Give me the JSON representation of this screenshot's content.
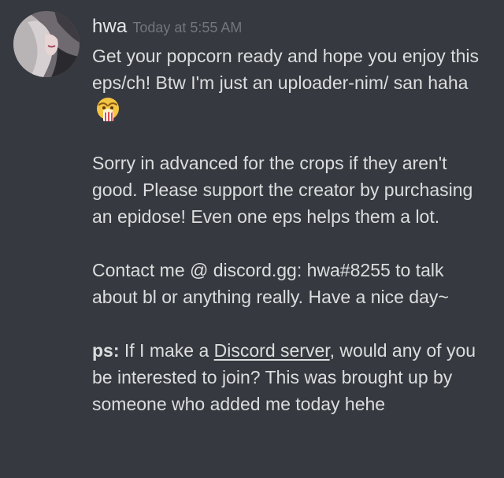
{
  "message": {
    "author": "hwa",
    "timestamp": "Today at 5:55 AM",
    "avatar_icon": "user-avatar",
    "paragraphs": {
      "p1_text": "Get your popcorn ready and hope you enjoy this eps/ch! Btw I'm just an uploader-nim/ san haha",
      "p1_emoji": "popcorn-emoji",
      "p2_text": "Sorry in advanced for the crops if they aren't good. Please support the creator by purchasing an epidose! Even one eps helps them a lot.",
      "p3_text": "Contact me @ discord.gg: hwa#8255 to talk about bl or anything really. Have a nice day~",
      "p4_bold": "ps:",
      "p4_before_link": " If I make a ",
      "p4_link": "Discord server",
      "p4_after_link": ", would any of you be interested to join? This was brought up by someone who added me today hehe"
    }
  },
  "colors": {
    "background": "#36393f",
    "username": "#e3e5e8",
    "timestamp": "#72767d",
    "text": "#dcddde"
  }
}
